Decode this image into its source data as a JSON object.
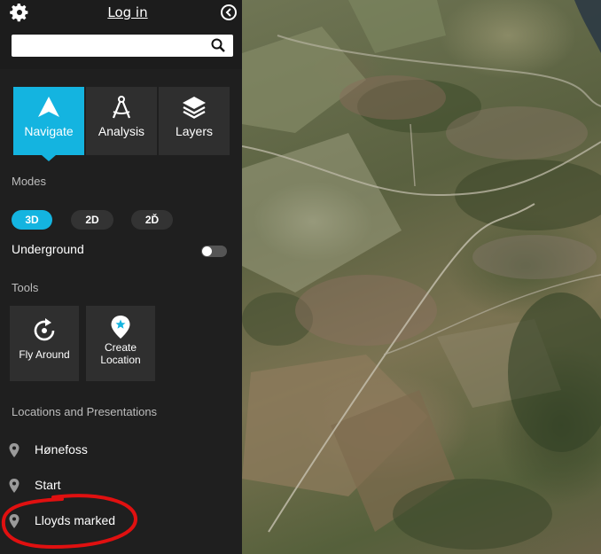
{
  "header": {
    "login_label": "Log in"
  },
  "search": {
    "value": "",
    "placeholder": ""
  },
  "tabs": [
    {
      "label": "Navigate",
      "icon": "navigate-arrow-icon",
      "active": true
    },
    {
      "label": "Analysis",
      "icon": "compass-drafting-icon",
      "active": false
    },
    {
      "label": "Layers",
      "icon": "layers-icon",
      "active": false
    }
  ],
  "modes": {
    "heading": "Modes",
    "options": [
      {
        "label": "3D",
        "active": true
      },
      {
        "label": "2D",
        "active": false
      },
      {
        "label": "2Ď",
        "active": false
      }
    ]
  },
  "underground": {
    "label": "Underground",
    "enabled": false
  },
  "tools": {
    "heading": "Tools",
    "items": [
      {
        "label": "Fly Around",
        "icon": "rotate-icon"
      },
      {
        "label": "Create Location",
        "icon": "location-pin-star-icon"
      }
    ]
  },
  "locations": {
    "heading": "Locations and Presentations",
    "items": [
      {
        "name": "Hønefoss"
      },
      {
        "name": "Start"
      },
      {
        "name": "Lloyds marked"
      }
    ]
  },
  "colors": {
    "accent": "#14b4e0",
    "sidebar": "#1f1f1f",
    "annotation": "#e01010"
  }
}
